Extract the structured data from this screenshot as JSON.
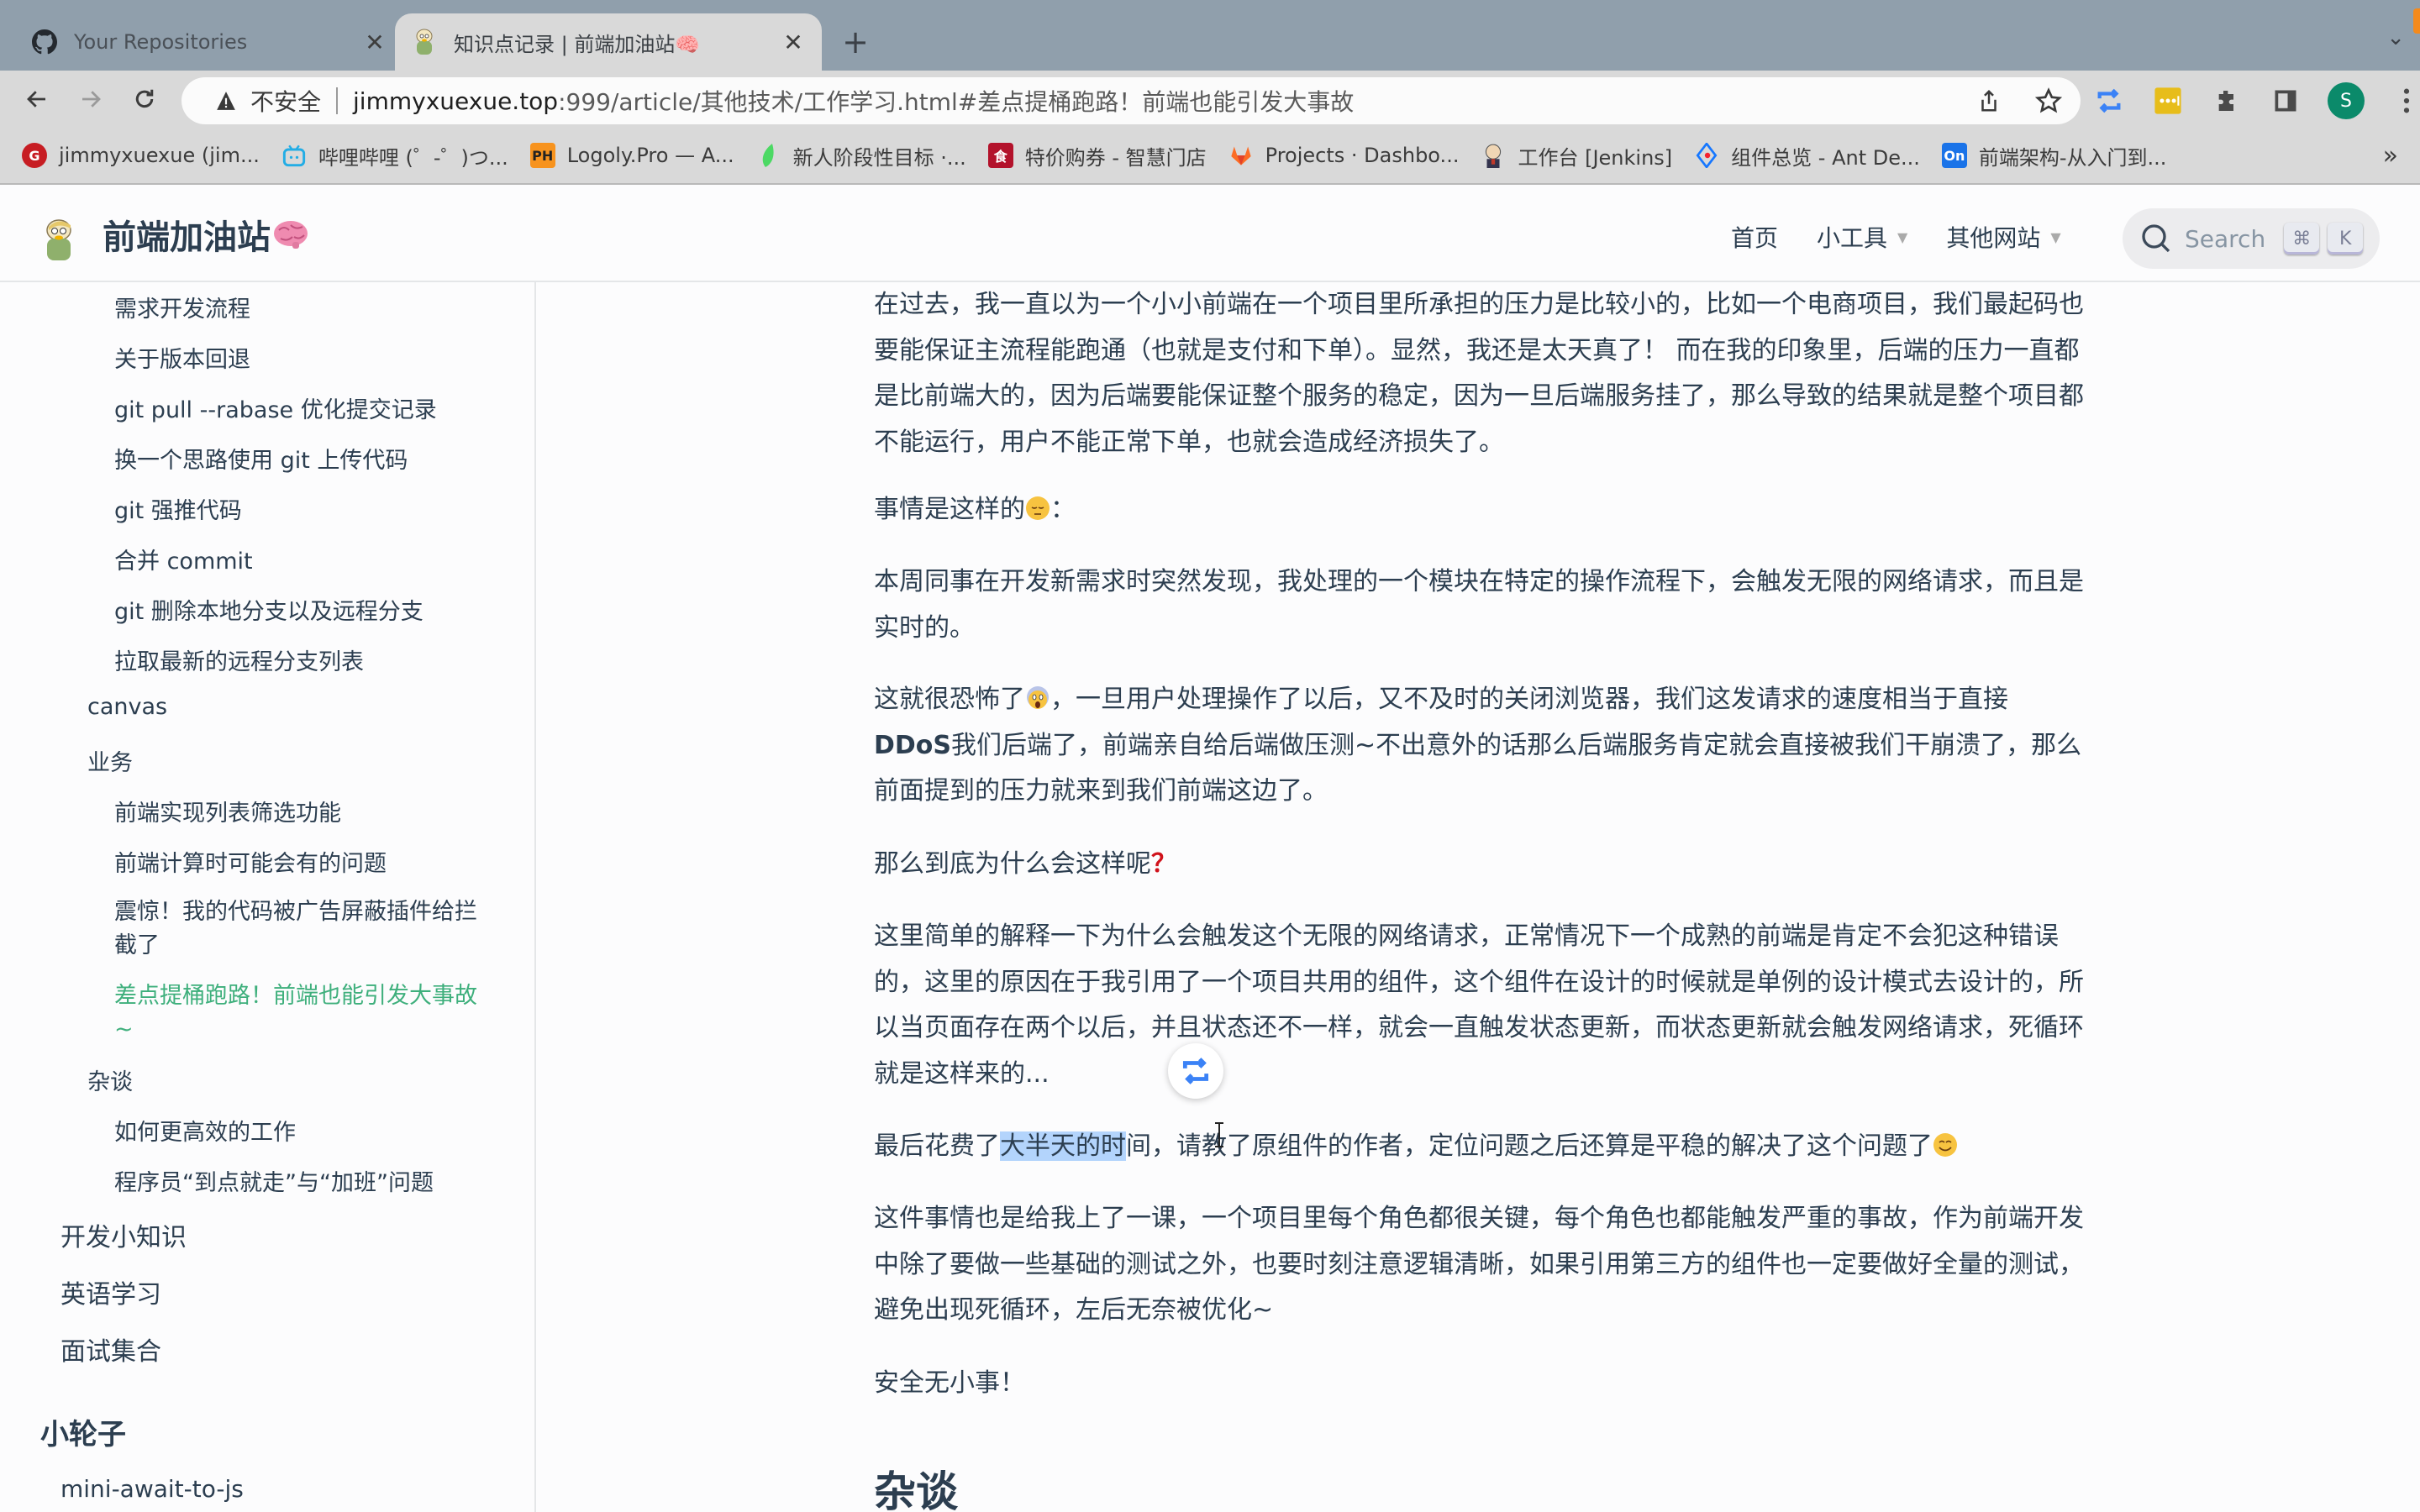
{
  "browser": {
    "tabs": [
      {
        "title": "Your Repositories",
        "icon": "github-icon",
        "active": false
      },
      {
        "title": "知识点记录 | 前端加油站🧠",
        "icon": "site-mascot-icon",
        "active": true
      }
    ],
    "close_glyph": "✕",
    "new_tab_glyph": "+",
    "tabstrip_chevron": "⌄",
    "address": {
      "security_label": "不安全",
      "url_host": "jimmyxuexue.top",
      "url_rest": ":999/article/其他技术/工作学习.html#差点提桶跑路！前端也能引发大事故"
    },
    "profile_initial": "S",
    "bookmarks": [
      {
        "label": "jimmyxuexue (jim...",
        "icon": "gitee-icon",
        "color": "#c71d23",
        "glyph": "G"
      },
      {
        "label": "哔哩哔哩 (゜-゜)つ...",
        "icon": "bilibili-icon",
        "color": "#23ade5",
        "glyph": ""
      },
      {
        "label": "Logoly.Pro — A...",
        "icon": "logoly-icon",
        "color": "#f7931e",
        "glyph": "PH"
      },
      {
        "label": "新人阶段性目标 ·...",
        "icon": "leaf-icon",
        "color": "#4cd964",
        "glyph": ""
      },
      {
        "label": "特价购券 - 智慧门店",
        "icon": "store-icon",
        "color": "#b3122b",
        "glyph": "食"
      },
      {
        "label": "Projects · Dashbo...",
        "icon": "gitlab-icon",
        "color": "#e24329",
        "glyph": ""
      },
      {
        "label": "工作台 [Jenkins]",
        "icon": "jenkins-icon",
        "color": "#d6b48a",
        "glyph": ""
      },
      {
        "label": "组件总览 - Ant De...",
        "icon": "antd-icon",
        "color": "#1677ff",
        "glyph": ""
      },
      {
        "label": "前端架构-从入门到...",
        "icon": "on-icon",
        "color": "#1a73e8",
        "glyph": "On"
      }
    ],
    "bookmarks_more": "»"
  },
  "site": {
    "title": "前端加油站",
    "nav": [
      {
        "label": "首页",
        "dropdown": false
      },
      {
        "label": "小工具",
        "dropdown": true
      },
      {
        "label": "其他网站",
        "dropdown": true
      }
    ],
    "caret": "▼",
    "search": {
      "placeholder": "Search",
      "key1": "⌘",
      "key2": "K"
    },
    "accent": "#3eaf7c"
  },
  "sidebar": {
    "items": [
      {
        "label": "需求开发流程",
        "level": 2
      },
      {
        "label": "关于版本回退",
        "level": 2
      },
      {
        "label": "git pull --rabase 优化提交记录",
        "level": 2
      },
      {
        "label": "换一个思路使用 git 上传代码",
        "level": 2
      },
      {
        "label": "git 强推代码",
        "level": 2
      },
      {
        "label": "合并 commit",
        "level": 2
      },
      {
        "label": "git 删除本地分支以及远程分支",
        "level": 2
      },
      {
        "label": "拉取最新的远程分支列表",
        "level": 2
      },
      {
        "label": "canvas",
        "level": 1
      },
      {
        "label": "业务",
        "level": 1
      },
      {
        "label": "前端实现列表筛选功能",
        "level": 2
      },
      {
        "label": "前端计算时可能会有的问题",
        "level": 2
      },
      {
        "label": "震惊！我的代码被广告屏蔽插件给拦截了",
        "level": 2
      },
      {
        "label": "差点提桶跑路！前端也能引发大事故~",
        "level": 2,
        "active": true
      },
      {
        "label": "杂谈",
        "level": 1
      },
      {
        "label": "如何更高效的工作",
        "level": 2
      },
      {
        "label": "程序员“到点就走”与“加班”问题",
        "level": 2
      },
      {
        "label": "开发小知识",
        "level": 0
      },
      {
        "label": "英语学习",
        "level": 0
      },
      {
        "label": "面试集合",
        "level": 0
      }
    ],
    "group2": {
      "title": "小轮子",
      "items": [
        {
          "label": "mini-await-to-js"
        }
      ]
    }
  },
  "article": {
    "p1": "在过去，我一直以为一个小小前端在一个项目里所承担的压力是比较小的，比如一个电商项目，我们最起码也要能保证主流程能跑通（也就是支付和下单）。显然，我还是太天真了！ 而在我的印象里，后端的压力一直都是比前端大的，因为后端要能保证整个服务的稳定，因为一旦后端服务挂了，那么导致的结果就是整个项目都不能运行，用户不能正常下单，也就会造成经济损失了。",
    "p2_text": "事情是这样的",
    "p2_tail": "：",
    "p3": "本周同事在开发新需求时突然发现，我处理的一个模块在特定的操作流程下，会触发无限的网络请求，而且是实时的。",
    "p4_a": "这就很恐怖了",
    "p4_b": "，一旦用户处理操作了以后，又不及时的关闭浏览器，我们这发请求的速度相当于直接",
    "p4_bold": "DDoS",
    "p4_c": "我们后端了，前端亲自给后端做压测~不出意外的话那么后端服务肯定就会直接被我们干崩溃了，那么前面提到的压力就来到我们前端这边了。",
    "p5_text": "那么到底为什么会这样呢",
    "p5_mark": "？",
    "p6": "这里简单的解释一下为什么会触发这个无限的网络请求，正常情况下一个成熟的前端是肯定不会犯这种错误的，这里的原因在于我引用了一个项目共用的组件，这个组件在设计的时候就是单例的设计模式去设计的，所以当页面存在两个以后，并且状态还不一样，就会一直触发状态更新，而状态更新就会触发网络请求，死循环就是这样来的...",
    "p7_a": "最后花费了",
    "p7_hl": "大半天的时",
    "p7_b": "间，请教了原组件的作者，定位问题之后还算是平稳的解决了这个问题了",
    "p8": "这件事情也是给我上了一课，一个项目里每个角色都很关键，每个角色也都能触发严重的事故，作为前端开发中除了要做一些基础的测试之外，也要时刻注意逻辑清晰，如果引用第三方的组件也一定要做好全量的测试，避免出现死循环，左后无奈被优化~",
    "p9": "安全无小事！",
    "h2": "杂谈"
  }
}
